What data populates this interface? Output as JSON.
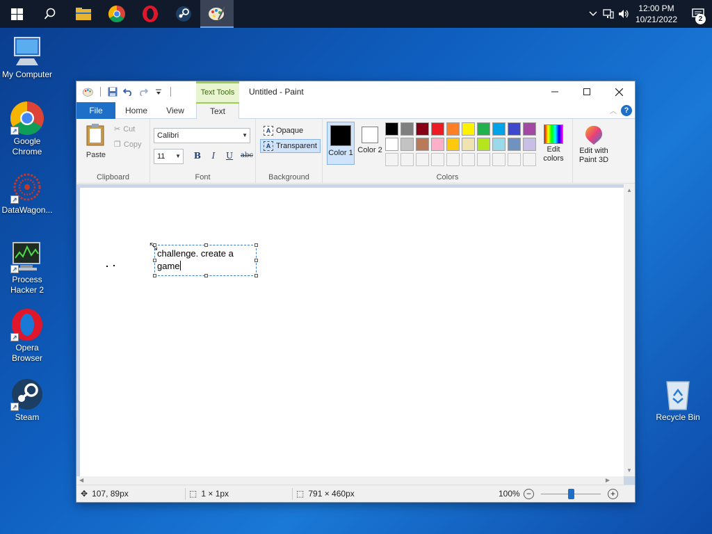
{
  "taskbar": {
    "pinned": [
      {
        "icon": "windows-start-icon"
      },
      {
        "icon": "search-icon"
      },
      {
        "icon": "file-explorer-icon"
      },
      {
        "icon": "chrome-icon"
      },
      {
        "icon": "opera-icon"
      },
      {
        "icon": "steam-icon"
      },
      {
        "icon": "paint-icon",
        "active": true
      }
    ],
    "clock_time": "12:00 PM",
    "clock_date": "10/21/2022",
    "notification_count": "2"
  },
  "desktop": {
    "icons": [
      {
        "label": "My Computer",
        "icon": "computer-icon"
      },
      {
        "label": "Google Chrome",
        "icon": "chrome-icon"
      },
      {
        "label": "DataWagon...",
        "icon": "datawagon-icon"
      },
      {
        "label": "Process Hacker 2",
        "icon": "process-hacker-icon"
      },
      {
        "label": "Opera Browser",
        "icon": "opera-icon"
      },
      {
        "label": "Steam",
        "icon": "steam-icon"
      },
      {
        "label": "Recycle Bin",
        "icon": "recycle-bin-icon"
      }
    ]
  },
  "paint": {
    "title": "Untitled - Paint",
    "context_tab": "Text Tools",
    "tabs": [
      "File",
      "Home",
      "View",
      "Text"
    ],
    "active_tab": "Text",
    "clipboard": {
      "paste": "Paste",
      "cut": "Cut",
      "copy": "Copy",
      "group_label": "Clipboard"
    },
    "font": {
      "family": "Calibri",
      "size": "11",
      "bold": "B",
      "italic": "I",
      "underline": "U",
      "strikethrough": "abc",
      "group_label": "Font"
    },
    "background": {
      "opaque": "Opaque",
      "transparent": "Transparent",
      "selected": "Transparent",
      "group_label": "Background"
    },
    "colors": {
      "color1_label": "Color 1",
      "color2_label": "Color 2",
      "color1": "#000000",
      "color2": "#ffffff",
      "edit_colors": "Edit colors",
      "edit_paint3d": "Edit with Paint 3D",
      "group_label": "Colors",
      "palette_row1": [
        "#000000",
        "#7f7f7f",
        "#880015",
        "#ed1c24",
        "#ff7f27",
        "#fff200",
        "#22b14c",
        "#00a2e8",
        "#3f48cc",
        "#a349a4"
      ],
      "palette_row2": [
        "#ffffff",
        "#c3c3c3",
        "#b97a57",
        "#ffaec9",
        "#ffc90e",
        "#efe4b0",
        "#b5e61d",
        "#99d9ea",
        "#7092be",
        "#c8bfe7"
      ],
      "palette_row3_count": 10
    },
    "canvas": {
      "text_line1": "challenge. create a",
      "text_line2": "game"
    },
    "status": {
      "cursor_pos": "107, 89px",
      "selection_size": "1 × 1px",
      "image_size": "791 × 460px",
      "zoom": "100%",
      "zoom_level_percent": 100
    }
  }
}
